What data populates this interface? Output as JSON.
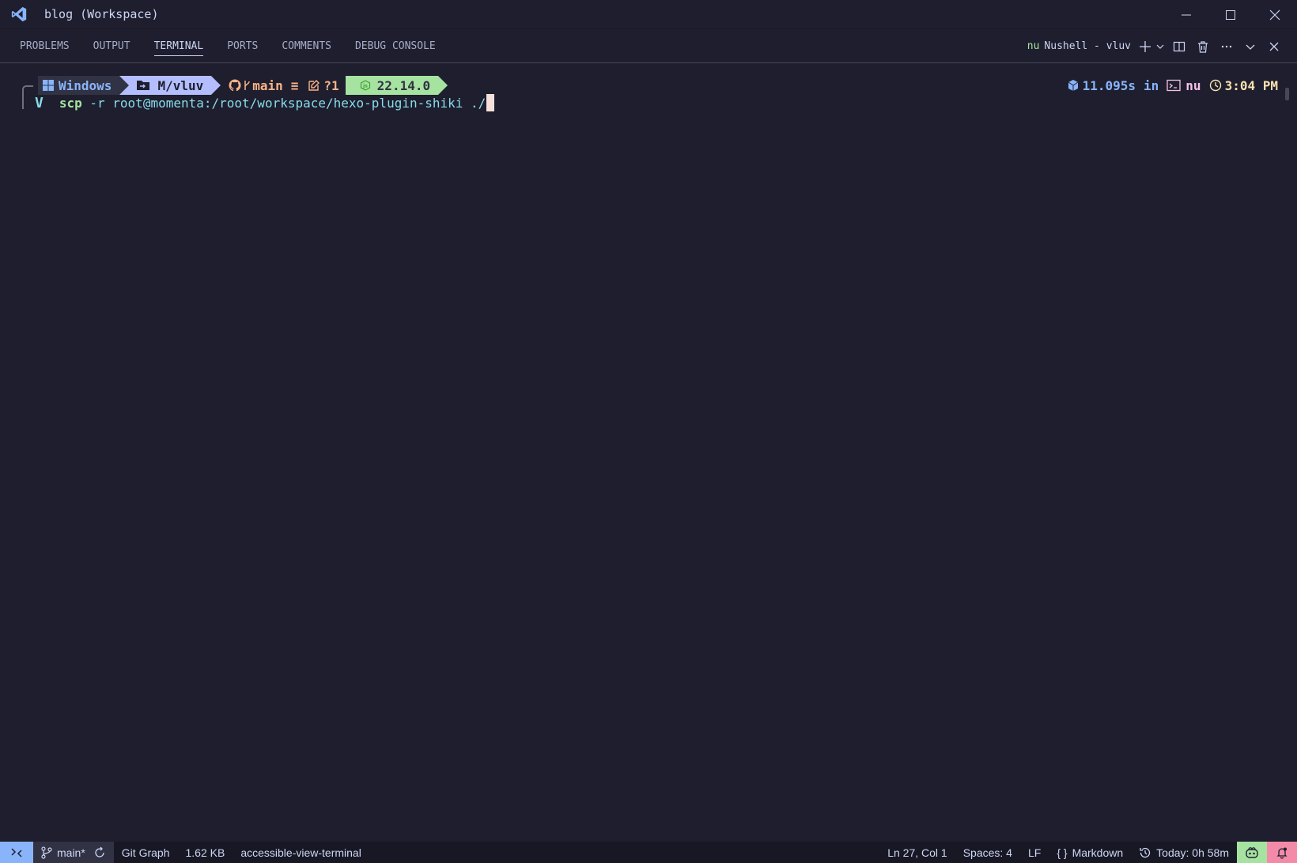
{
  "window": {
    "title": "blog (Workspace)"
  },
  "panel": {
    "tabs": [
      {
        "label": "PROBLEMS"
      },
      {
        "label": "OUTPUT"
      },
      {
        "label": "TERMINAL"
      },
      {
        "label": "PORTS"
      },
      {
        "label": "COMMENTS"
      },
      {
        "label": "DEBUG CONSOLE"
      }
    ],
    "active_tab": "TERMINAL",
    "terminal_shell_label": "nu",
    "terminal_name": "Nushell - vluv"
  },
  "terminal": {
    "prompt": {
      "os": "Windows",
      "dir": "M/vluv",
      "branch": "main",
      "git_state": "≡",
      "untracked": "?1",
      "node_version": "22.14.0"
    },
    "right_prompt": {
      "duration": "11.095s",
      "in_label": "in",
      "shell": "nu",
      "time": "3:04 PM"
    },
    "prompt_char": "V",
    "command": "scp",
    "args": " -r root@momenta:/root/workspace/hexo-plugin-shiki ./"
  },
  "statusbar": {
    "branch": "main*",
    "git_graph": "Git Graph",
    "file_size": "1.62 KB",
    "context": "accessible-view-terminal",
    "position": "Ln 27, Col 1",
    "spaces": "Spaces: 4",
    "eol": "LF",
    "language": "Markdown",
    "time_tracker": "Today: 0h 58m"
  },
  "colors": {
    "background": "#1e1e2e",
    "accent_blue": "#89b4fa",
    "green": "#a6e3a1",
    "lavender": "#b4befe",
    "peach": "#fab387",
    "red": "#f38ba8"
  },
  "icons": [
    "vscode-logo-icon",
    "minimize-icon",
    "maximize-icon",
    "close-icon",
    "plus-icon",
    "chevron-down-icon",
    "split-icon",
    "trash-icon",
    "more-icon",
    "windows-icon",
    "folder-icon",
    "github-icon",
    "edit-icon",
    "node-icon",
    "cube-icon",
    "terminal-icon",
    "clock-icon",
    "remote-icon",
    "branch-icon",
    "sync-icon",
    "braces-icon",
    "history-icon",
    "copilot-icon",
    "bell-icon"
  ]
}
